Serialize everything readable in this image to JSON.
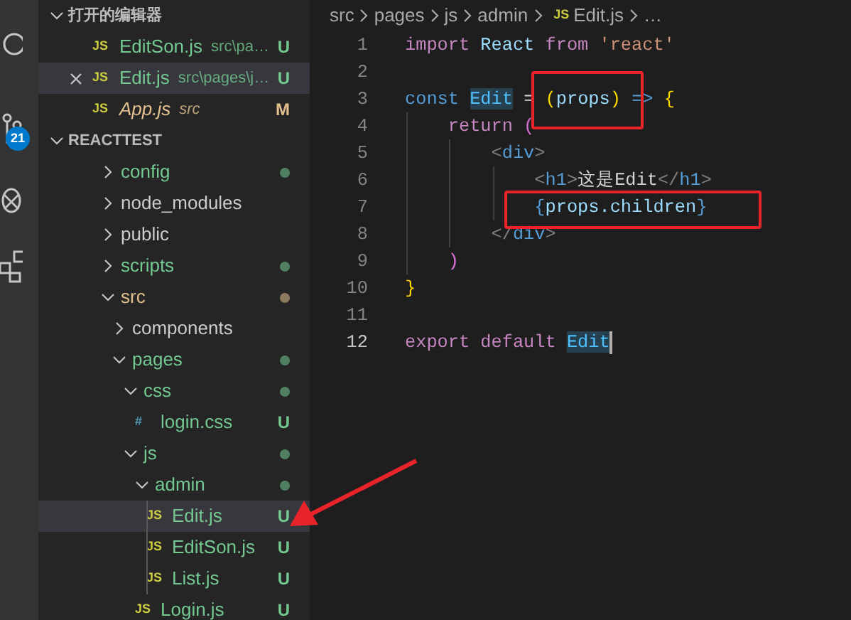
{
  "activity_bar": {
    "badge": "21"
  },
  "sidebar": {
    "open_editors": {
      "title": "打开的编辑器",
      "expanded": true,
      "items": [
        {
          "name": "EditSon.js",
          "kind": "js",
          "icon": "JS",
          "path": "src\\pa…",
          "status": "U",
          "color": "#73c991",
          "preview": false,
          "selected": false
        },
        {
          "name": "Edit.js",
          "kind": "js",
          "icon": "JS",
          "path": "src\\pages\\j…",
          "status": "U",
          "color": "#73c991",
          "preview": false,
          "selected": true
        },
        {
          "name": "App.js",
          "kind": "js",
          "icon": "JS",
          "path": "src",
          "status": "M",
          "color": "#e2c08d",
          "preview": true,
          "selected": false
        }
      ]
    },
    "project": {
      "title": "REACTTEST",
      "expanded": true,
      "tree": [
        {
          "name": "config",
          "kind": "folder",
          "expanded": false,
          "color": "#73c991",
          "dot": true,
          "selected": false
        },
        {
          "name": "node_modules",
          "kind": "folder",
          "expanded": false,
          "color": "#cccccc",
          "dot": false,
          "selected": false
        },
        {
          "name": "public",
          "kind": "folder",
          "expanded": false,
          "color": "#cccccc",
          "dot": false,
          "selected": false
        },
        {
          "name": "scripts",
          "kind": "folder",
          "expanded": false,
          "color": "#73c991",
          "dot": true,
          "selected": false
        },
        {
          "name": "src",
          "kind": "folder",
          "expanded": true,
          "color": "#e2c08d",
          "dot": true,
          "selected": false,
          "children": [
            {
              "name": "components",
              "kind": "folder",
              "expanded": false,
              "color": "#cccccc",
              "dot": false,
              "selected": false
            },
            {
              "name": "pages",
              "kind": "folder",
              "expanded": true,
              "color": "#73c991",
              "dot": true,
              "selected": false,
              "children": [
                {
                  "name": "css",
                  "kind": "folder",
                  "expanded": true,
                  "color": "#73c991",
                  "dot": true,
                  "selected": false,
                  "children": [
                    {
                      "name": "login.css",
                      "kind": "css",
                      "icon": "#",
                      "status": "U",
                      "color": "#73c991",
                      "selected": false
                    }
                  ]
                },
                {
                  "name": "js",
                  "kind": "folder",
                  "expanded": true,
                  "color": "#73c991",
                  "dot": true,
                  "selected": false,
                  "children": [
                    {
                      "name": "admin",
                      "kind": "folder",
                      "expanded": true,
                      "color": "#73c991",
                      "dot": true,
                      "selected": false,
                      "children": [
                        {
                          "name": "Edit.js",
                          "kind": "js",
                          "icon": "JS",
                          "status": "U",
                          "color": "#73c991",
                          "selected": true
                        },
                        {
                          "name": "EditSon.js",
                          "kind": "js",
                          "icon": "JS",
                          "status": "U",
                          "color": "#73c991",
                          "selected": false
                        },
                        {
                          "name": "List.js",
                          "kind": "js",
                          "icon": "JS",
                          "status": "U",
                          "color": "#73c991",
                          "selected": false
                        }
                      ]
                    },
                    {
                      "name": "Login.js",
                      "kind": "js",
                      "icon": "JS",
                      "status": "U",
                      "color": "#73c991",
                      "selected": false
                    }
                  ]
                }
              ]
            }
          ]
        }
      ]
    }
  },
  "editor": {
    "breadcrumb": [
      {
        "text": "src"
      },
      {
        "text": "pages"
      },
      {
        "text": "js"
      },
      {
        "text": "admin"
      },
      {
        "text": "Edit.js",
        "icon": "JS"
      },
      {
        "text": "…"
      }
    ],
    "lines": [
      {
        "number": "1",
        "current": false,
        "tokens": [
          {
            "kind": "keyword",
            "text": "import "
          },
          {
            "kind": "variable",
            "text": "React"
          },
          {
            "kind": "keyword",
            "text": " from "
          },
          {
            "kind": "string",
            "text": "'react'"
          }
        ]
      },
      {
        "number": "2",
        "current": false
      },
      {
        "number": "3",
        "current": false,
        "tokens": [
          {
            "kind": "storage",
            "text": "const "
          },
          {
            "kind": "constant",
            "text": "Edit",
            "highlight": true
          },
          {
            "kind": "operator",
            "text": " = "
          },
          {
            "kind": "bracket1",
            "text": "("
          },
          {
            "kind": "variable",
            "text": "props"
          },
          {
            "kind": "bracket1",
            "text": ")"
          },
          {
            "kind": "storage",
            "text": " => "
          },
          {
            "kind": "bracket1",
            "text": "{"
          }
        ]
      },
      {
        "number": "4",
        "current": false,
        "tokens": [
          {
            "kind": "keyword",
            "text": "    return "
          },
          {
            "kind": "bracket2",
            "text": "("
          }
        ]
      },
      {
        "number": "5",
        "current": false,
        "tokens": [
          {
            "kind": "tagpunct",
            "text": "        <"
          },
          {
            "kind": "tag",
            "text": "div"
          },
          {
            "kind": "tagpunct",
            "text": ">"
          }
        ]
      },
      {
        "number": "6",
        "current": false,
        "tokens": [
          {
            "kind": "tagpunct",
            "text": "            <"
          },
          {
            "kind": "tag",
            "text": "h1"
          },
          {
            "kind": "tagpunct",
            "text": ">"
          },
          {
            "kind": "text",
            "text": "这是Edit"
          },
          {
            "kind": "tagpunct",
            "text": "</"
          },
          {
            "kind": "tag",
            "text": "h1"
          },
          {
            "kind": "tagpunct",
            "text": ">"
          }
        ]
      },
      {
        "number": "7",
        "current": false,
        "tokens": [
          {
            "kind": "storage",
            "text": "            {"
          },
          {
            "kind": "variable",
            "text": "props.children"
          },
          {
            "kind": "storage",
            "text": "}"
          }
        ]
      },
      {
        "number": "8",
        "current": false,
        "tokens": [
          {
            "kind": "tagpunct",
            "text": "        </"
          },
          {
            "kind": "tag",
            "text": "div"
          },
          {
            "kind": "tagpunct",
            "text": ">"
          }
        ]
      },
      {
        "number": "9",
        "current": false,
        "tokens": [
          {
            "kind": "bracket2",
            "text": "    )"
          }
        ]
      },
      {
        "number": "10",
        "current": false,
        "tokens": [
          {
            "kind": "bracket1",
            "text": "}"
          }
        ]
      },
      {
        "number": "11",
        "current": false
      },
      {
        "number": "12",
        "current": true,
        "tokens": [
          {
            "kind": "keyword",
            "text": "export default "
          },
          {
            "kind": "constant",
            "text": "Edit",
            "highlight": true
          }
        ]
      }
    ]
  }
}
